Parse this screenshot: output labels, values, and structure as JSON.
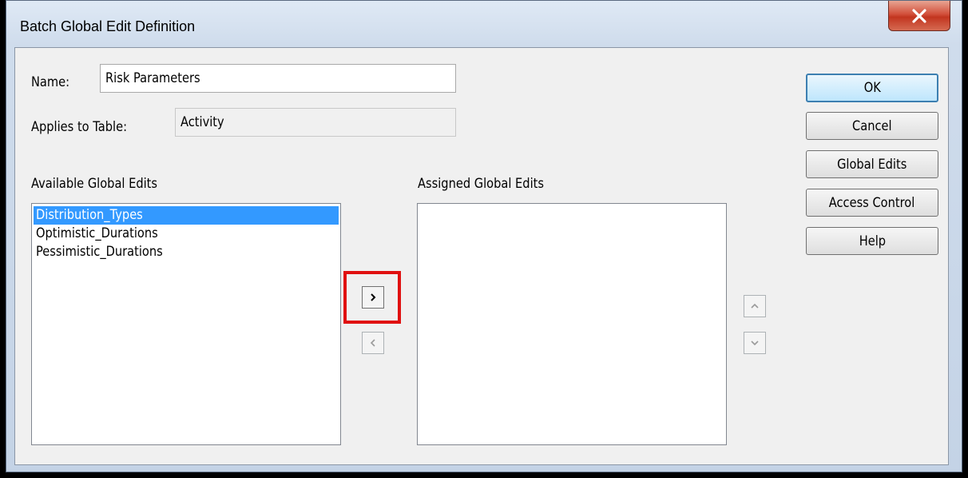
{
  "window": {
    "title": "Batch Global Edit Definition",
    "close_icon": "close-icon"
  },
  "form": {
    "name_label": "Name:",
    "name_value": "Risk Parameters",
    "applies_label": "Applies to Table:",
    "applies_value": "Activity"
  },
  "available": {
    "label": "Available Global Edits",
    "items": [
      "Distribution_Types",
      "Optimistic_Durations",
      "Pessimistic_Durations"
    ],
    "selected_index": 0
  },
  "assigned": {
    "label": "Assigned Global Edits",
    "items": []
  },
  "buttons": {
    "ok": "OK",
    "cancel": "Cancel",
    "global_edits": "Global Edits",
    "access_control": "Access Control",
    "help": "Help"
  },
  "arrows": {
    "add": "chevron-right-icon",
    "remove": "chevron-left-icon",
    "move_up": "chevron-up-icon",
    "move_down": "chevron-down-icon"
  },
  "colors": {
    "selection": "#3399ff",
    "highlight": "#e01010",
    "default_button_border": "#3c7fb1"
  }
}
